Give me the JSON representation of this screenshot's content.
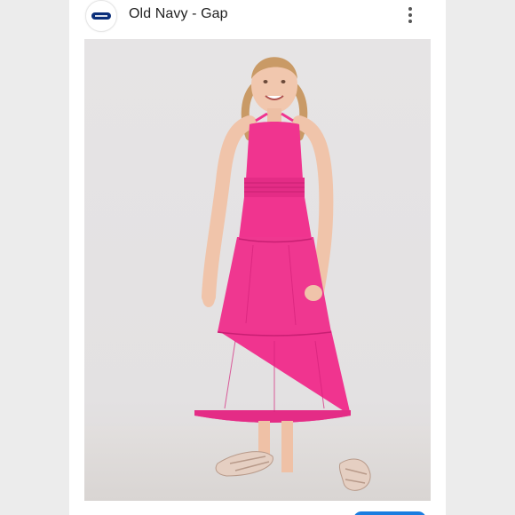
{
  "header": {
    "brand_name": "Old Navy - Gap",
    "logo_icon": "old-navy-logo-icon",
    "menu_icon": "more-vert-icon"
  },
  "photo": {
    "subject": "product-photo",
    "colors": {
      "dress": "#f0348f",
      "dress_shade": "#d4217a",
      "background": "#e5e3e4"
    }
  },
  "footer": {
    "text": "",
    "button_color": "#1a7de0"
  }
}
